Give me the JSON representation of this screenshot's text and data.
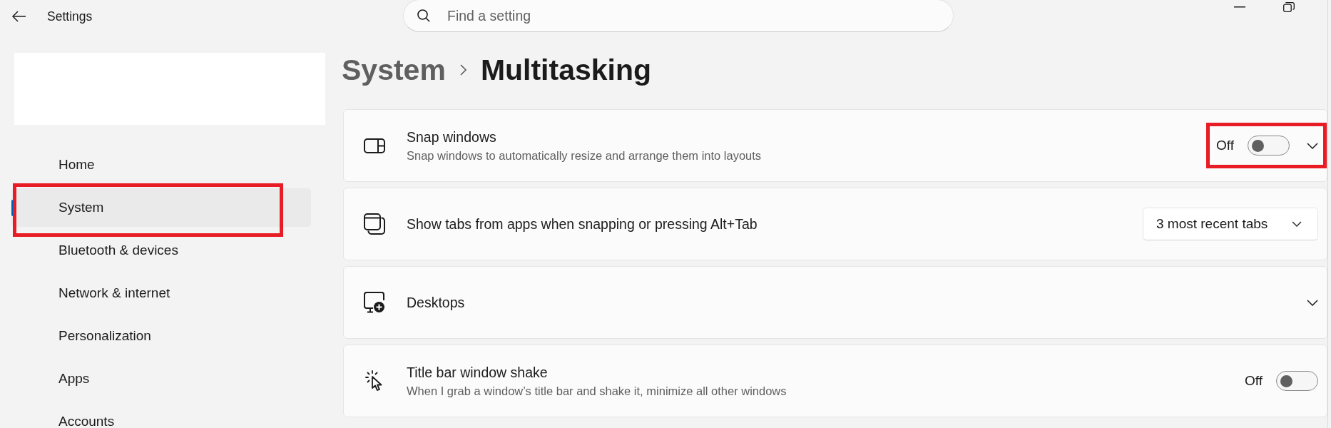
{
  "window": {
    "title": "Settings"
  },
  "search": {
    "placeholder": "Find a setting"
  },
  "sidebar": {
    "items": [
      {
        "label": "Home",
        "selected": false,
        "highlighted": false
      },
      {
        "label": "System",
        "selected": true,
        "highlighted": true
      },
      {
        "label": "Bluetooth & devices",
        "selected": false,
        "highlighted": false
      },
      {
        "label": "Network & internet",
        "selected": false,
        "highlighted": false
      },
      {
        "label": "Personalization",
        "selected": false,
        "highlighted": false
      },
      {
        "label": "Apps",
        "selected": false,
        "highlighted": false
      },
      {
        "label": "Accounts",
        "selected": false,
        "highlighted": false
      }
    ]
  },
  "breadcrumb": {
    "parent": "System",
    "current": "Multitasking"
  },
  "settings": [
    {
      "kind": "toggle_expand",
      "title": "Snap windows",
      "description": "Snap windows to automatically resize and arrange them into layouts",
      "state_label": "Off",
      "on": false,
      "expanded": false,
      "highlighted": true
    },
    {
      "kind": "dropdown",
      "title": "Show tabs from apps when snapping or pressing Alt+Tab",
      "value": "3 most recent tabs",
      "highlighted": false
    },
    {
      "kind": "expander",
      "title": "Desktops",
      "expanded": false,
      "highlighted": false
    },
    {
      "kind": "toggle",
      "title": "Title bar window shake",
      "description": "When I grab a window’s title bar and shake it, minimize all other windows",
      "state_label": "Off",
      "on": false,
      "highlighted": false
    }
  ]
}
